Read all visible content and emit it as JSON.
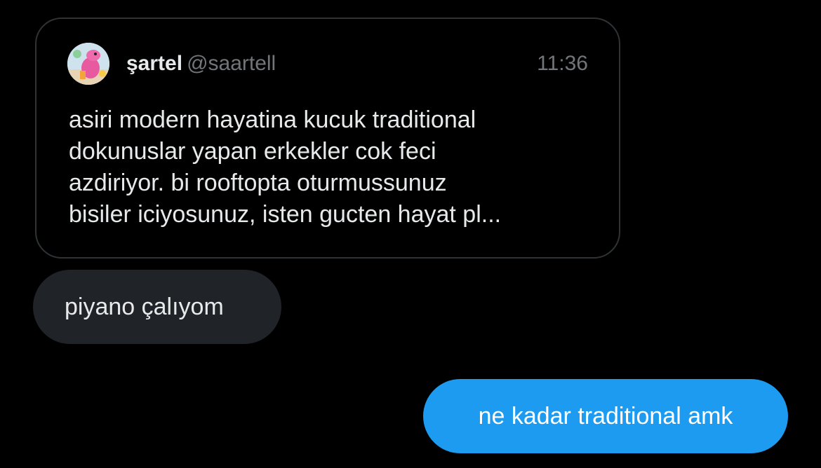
{
  "quoted_post": {
    "author_name": "şartel",
    "author_handle": "@saartell",
    "time": "11:36",
    "text_lines": [
      "asiri modern hayatina kucuk traditional",
      "dokunuslar yapan erkekler cok feci",
      "azdiriyor. bi rooftopta oturmussunuz",
      "bisiler iciyosunuz, isten gucten hayat pl..."
    ],
    "avatar_icon": "pink-lizard-avatar"
  },
  "messages": {
    "received": "piyano çalıyom",
    "sent": "ne kadar traditional amk"
  },
  "colors": {
    "background": "#000000",
    "received_bubble": "#202327",
    "sent_bubble": "#1d9bf0",
    "card_border": "#2f3336",
    "muted_text": "#71767b"
  }
}
